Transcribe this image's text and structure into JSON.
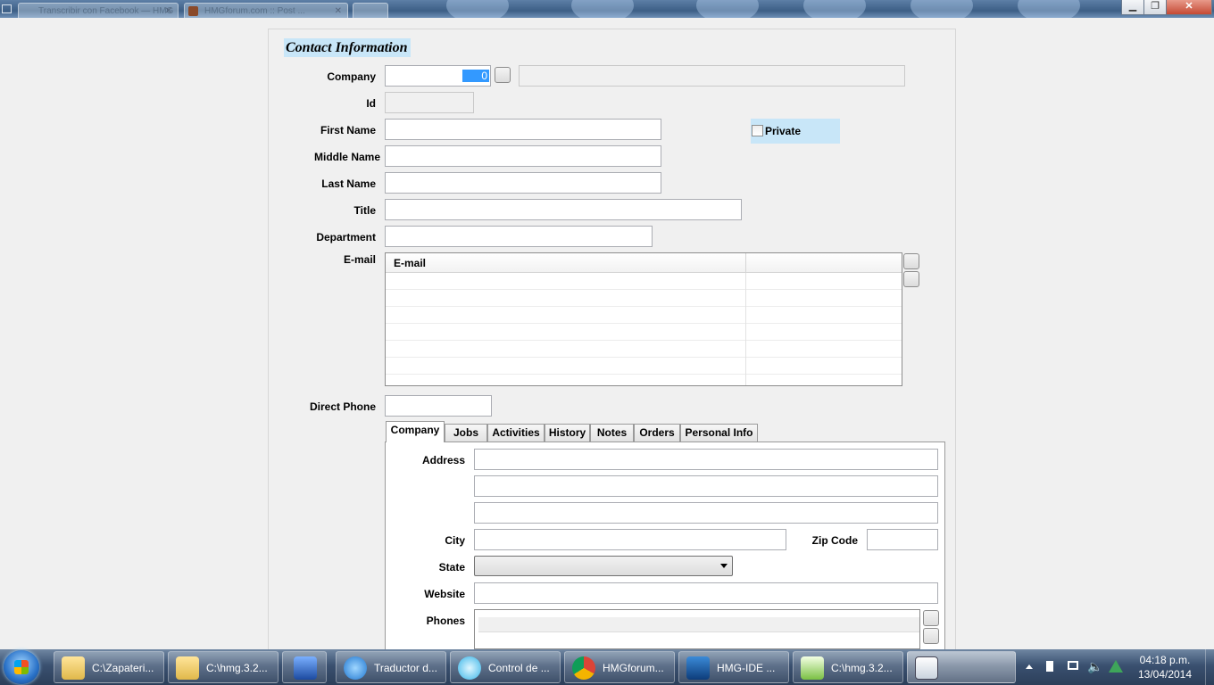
{
  "browser": {
    "tabs": [
      {
        "label": "Transcribir con Facebook — HMG"
      },
      {
        "label": "HMGforum.com :: Post ..."
      },
      {
        "label": ""
      }
    ],
    "window_controls": {
      "minimize": "▁",
      "restore": "❐",
      "close": "✕"
    }
  },
  "form": {
    "section_title": "Contact Information",
    "company": {
      "label": "Company",
      "value": "0"
    },
    "id_label": "Id",
    "first_name_label": "First Name",
    "middle_name_label": "Middle Name",
    "last_name_label": "Last Name",
    "title_label": "Title",
    "department_label": "Department",
    "private_label": "Private",
    "email": {
      "label": "E-mail",
      "columns": [
        "E-mail",
        ""
      ]
    },
    "direct_phone_label": "Direct Phone",
    "tabs": [
      "Company",
      "Jobs",
      "Activities",
      "History",
      "Notes",
      "Orders",
      "Personal Info"
    ],
    "address_label": "Address",
    "city_label": "City",
    "zip_label": "Zip Code",
    "state_label": "State",
    "website_label": "Website",
    "phones_label": "Phones"
  },
  "taskbar": {
    "items": [
      {
        "label": "C:\\Zapateri..."
      },
      {
        "label": "C:\\hmg.3.2..."
      },
      {
        "label": ""
      },
      {
        "label": "Traductor d..."
      },
      {
        "label": "Control de ..."
      },
      {
        "label": "HMGforum..."
      },
      {
        "label": "HMG-IDE ..."
      },
      {
        "label": "C:\\hmg.3.2..."
      },
      {
        "label": ""
      }
    ],
    "clock_time": "04:18 p.m.",
    "clock_date": "13/04/2014",
    "colors": {
      "accent": "#3399ff",
      "taskbar": "#2c3f5a"
    }
  }
}
